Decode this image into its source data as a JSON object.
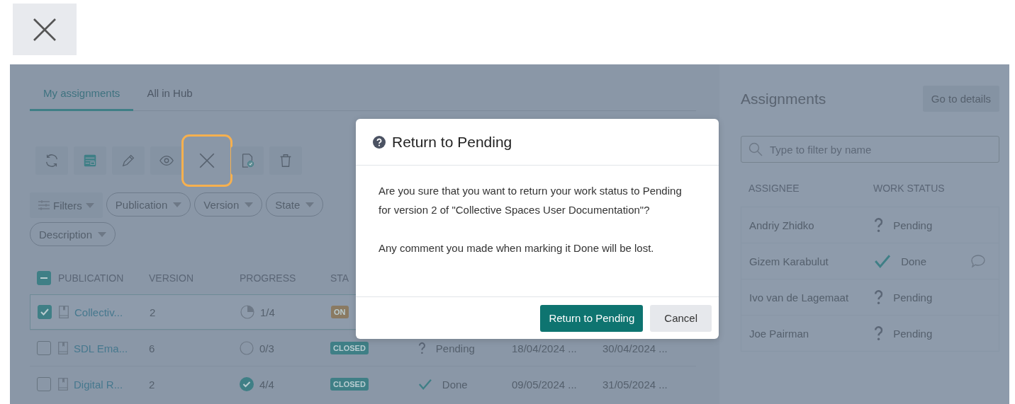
{
  "tabs": [
    {
      "label": "My assignments",
      "selected": true
    },
    {
      "label": "All in Hub",
      "selected": false
    }
  ],
  "toolbar": [
    {
      "kind": "refresh",
      "highlighted": false
    },
    {
      "kind": "table",
      "highlighted": false
    },
    {
      "kind": "pencil",
      "highlighted": false
    },
    {
      "kind": "eye",
      "highlighted": false
    },
    {
      "kind": "close",
      "highlighted": true
    },
    {
      "kind": "doc-check",
      "highlighted": false
    },
    {
      "kind": "trash",
      "highlighted": false
    }
  ],
  "filters": {
    "label": "Filters",
    "chips": [
      "Publication",
      "Version",
      "State",
      "Description"
    ]
  },
  "table": {
    "select_all_indeterminate": true,
    "columns": [
      "PUBLICATION",
      "VERSION",
      "PROGRESS",
      "STA"
    ],
    "rows": [
      {
        "selected": true,
        "checked": true,
        "publication": "Collectiv...",
        "version": "2",
        "progress": {
          "text": "1/4",
          "kind": "quarter"
        },
        "state": "ON",
        "color": "#8a7a62"
      },
      {
        "selected": false,
        "checked": false,
        "publication": "SDL Ema...",
        "version": "6",
        "progress": {
          "text": "0/3",
          "kind": "empty"
        },
        "state": "CLOSED",
        "color": "#3f7f86",
        "work_status": "Pending",
        "kind": "pending",
        "start": "18/04/2024 ...",
        "due": "30/04/2024 ..."
      },
      {
        "selected": false,
        "checked": false,
        "publication": "Digital R...",
        "version": "2",
        "progress": {
          "text": "4/4",
          "kind": "complete"
        },
        "state": "CLOSED",
        "color": "#3f7f86",
        "work_status": "Done",
        "kind": "done",
        "start": "09/05/2024 ...",
        "due": "31/05/2024 ..."
      }
    ]
  },
  "assignments": {
    "title": "Assignments",
    "details_button": "Go to details",
    "search": {
      "placeholder": "Type to filter by name"
    },
    "columns": [
      "ASSIGNEE",
      "WORK STATUS"
    ],
    "rows": [
      {
        "name": "Andriy Zhidko",
        "status": "Pending",
        "kind": "pending",
        "comment": false
      },
      {
        "name": "Gizem Karabulut",
        "status": "Done",
        "kind": "done",
        "comment": true
      },
      {
        "name": "Ivo van de Lagemaat",
        "status": "Pending",
        "kind": "pending",
        "comment": false
      },
      {
        "name": "Joe Pairman",
        "status": "Pending",
        "kind": "pending",
        "comment": false
      }
    ]
  },
  "dialog": {
    "title": "Return to Pending",
    "paragraphs": [
      "Are you sure that you want to return your work status to Pending for version 2 of \"Collective Spaces User Documentation\"?",
      "Any comment you made when marking it Done will be lost."
    ],
    "buttons": [
      {
        "label": "Return to Pending",
        "kind": "primary"
      },
      {
        "label": "Cancel",
        "kind": "secondary"
      }
    ]
  }
}
